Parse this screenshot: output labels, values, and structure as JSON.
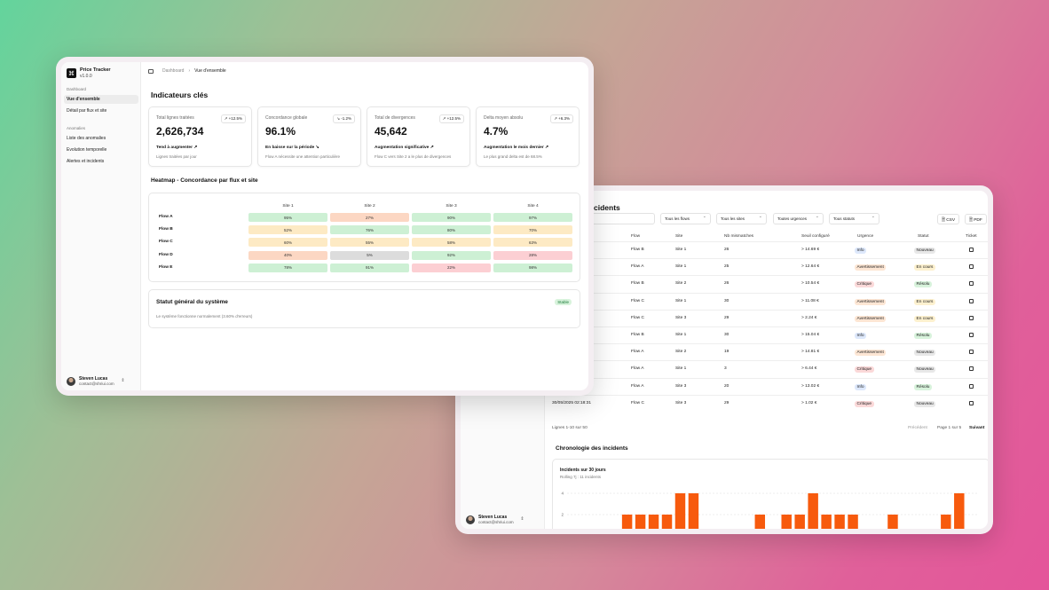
{
  "win1": {
    "app": {
      "name": "Price Tracker",
      "version": "v1.0.0"
    },
    "sidebar": {
      "section1": "Dashboard",
      "items1": [
        "Vue d'ensemble",
        "Détail par flux et site"
      ],
      "section2": "Anomalies",
      "items2": [
        "Liste des anomalies",
        "Evolution temporelle",
        "Alertes et incidents"
      ]
    },
    "user": {
      "name": "Steven Lucas",
      "email": "contact@shriui.com"
    },
    "breadcrumb": {
      "root": "Dashboard",
      "current": "Vue d'ensemble"
    },
    "kpi_title": "Indicateurs clés",
    "kpis": [
      {
        "label": "Total lignes traitées",
        "delta": "+12.5%",
        "value": "2,626,734",
        "trend": "Tend à augmenter",
        "sub": "Lignes traitées par jour"
      },
      {
        "label": "Concordance globale",
        "delta": "-1.2%",
        "value": "96.1%",
        "trend": "En baisse sur la période",
        "sub": "Flow A nécessite une attention particulière"
      },
      {
        "label": "Total de divergences",
        "delta": "+12.5%",
        "value": "45,642",
        "trend": "Augmentation significative",
        "sub": "Flow C vers Site 2 a le plus de divergences"
      },
      {
        "label": "Delta moyen absolu",
        "delta": "+6.3%",
        "value": "4.7%",
        "trend": "Augmentation le mois dernier",
        "sub": "Le plus grand delta est de 68.5%"
      }
    ],
    "heatmap": {
      "title": "Heatmap - Concordance par flux et site",
      "columns": [
        "Site 1",
        "Site 2",
        "Site 3",
        "Site 4"
      ],
      "rows": [
        {
          "label": "Flow A",
          "values": [
            "95%",
            "27%",
            "90%",
            "97%"
          ]
        },
        {
          "label": "Flow B",
          "values": [
            "52%",
            "76%",
            "80%",
            "70%"
          ]
        },
        {
          "label": "Flow C",
          "values": [
            "60%",
            "55%",
            "58%",
            "63%"
          ]
        },
        {
          "label": "Flow D",
          "values": [
            "40%",
            "5%",
            "92%",
            "28%"
          ]
        },
        {
          "label": "Flow E",
          "values": [
            "78%",
            "91%",
            "22%",
            "98%"
          ]
        }
      ],
      "colors": {
        "green": "#cdf0d4",
        "orange": "#fcd7c3",
        "yellow": "#fdeac4",
        "gray": "#dcdcdc",
        "red": "#fccfd3"
      }
    },
    "status": {
      "title": "Statut général du système",
      "badge": "Stable",
      "sub": "Le système fonctionne normalement (3.60% d'erreurs)"
    }
  },
  "win2": {
    "title": "cidents",
    "filters": [
      "Tous les flows",
      "Tous les sites",
      "Toutes urgences",
      "Tous statuts"
    ],
    "buttons": {
      "csv": "CSV",
      "pdf": "PDF"
    },
    "headers": [
      "Flow",
      "Site",
      "Nb mismatches",
      "Seuil configuré",
      "Urgence",
      "Statut",
      "Ticket"
    ],
    "rows": [
      {
        "date": "",
        "flow": "Flow B",
        "site": "Site 1",
        "nb": "26",
        "seuil": "> 14.69 €",
        "urgence": "Info",
        "statut": "Nouveau"
      },
      {
        "date": "",
        "flow": "Flow A",
        "site": "Site 1",
        "nb": "25",
        "seuil": "> 12.64 €",
        "urgence": "Avertissement",
        "statut": "En cours"
      },
      {
        "date": "",
        "flow": "Flow B",
        "site": "Site 2",
        "nb": "26",
        "seuil": "> 10.54 €",
        "urgence": "Critique",
        "statut": "Résolu"
      },
      {
        "date": "",
        "flow": "Flow C",
        "site": "Site 1",
        "nb": "30",
        "seuil": "> 11.08 €",
        "urgence": "Avertissement",
        "statut": "En cours"
      },
      {
        "date": "",
        "flow": "Flow C",
        "site": "Site 3",
        "nb": "29",
        "seuil": "> 2.24 €",
        "urgence": "Avertissement",
        "statut": "En cours"
      },
      {
        "date": "",
        "flow": "Flow B",
        "site": "Site 1",
        "nb": "30",
        "seuil": "> 15.04 €",
        "urgence": "Info",
        "statut": "Résolu"
      },
      {
        "date": "",
        "flow": "Flow A",
        "site": "Site 2",
        "nb": "19",
        "seuil": "> 14.81 €",
        "urgence": "Avertissement",
        "statut": "Nouveau"
      },
      {
        "date": "",
        "flow": "Flow A",
        "site": "Site 1",
        "nb": "3",
        "seuil": "> 6.44 €",
        "urgence": "Critique",
        "statut": "Nouveau"
      },
      {
        "date": "",
        "flow": "Flow A",
        "site": "Site 3",
        "nb": "20",
        "seuil": "> 13.02 €",
        "urgence": "Info",
        "statut": "Résolu"
      },
      {
        "date": "30/05/2025 02:18:31",
        "flow": "Flow C",
        "site": "Site 3",
        "nb": "29",
        "seuil": "> 1.02 €",
        "urgence": "Critique",
        "statut": "Nouveau"
      }
    ],
    "footer": {
      "count": "Lignes 1-10 sur 50",
      "prev": "Précédent",
      "page": "Page 1 sur 5",
      "next": "Suivant"
    },
    "chronologie": "Chronologie des incidents",
    "chart_title": "Incidents sur 30 jours",
    "chart_sub": "Rolling 7j : 11 incidents",
    "user": {
      "name": "Steven Lucas",
      "email": "contact@shriui.com"
    },
    "bar_color": "#f75a0d"
  },
  "chart_data": {
    "type": "bar",
    "title": "Incidents sur 30 jours",
    "subtitle": "Rolling 7j : 11 incidents",
    "ytick_labels": [
      "4",
      "2",
      "0"
    ],
    "ylim": [
      0,
      4
    ],
    "values": [
      0,
      0,
      0,
      0,
      2,
      2,
      2,
      2,
      4,
      4,
      0,
      0,
      0,
      0,
      2,
      0,
      2,
      2,
      4,
      2,
      2,
      2,
      0,
      0,
      2,
      0,
      0,
      0,
      2,
      4,
      0
    ]
  }
}
